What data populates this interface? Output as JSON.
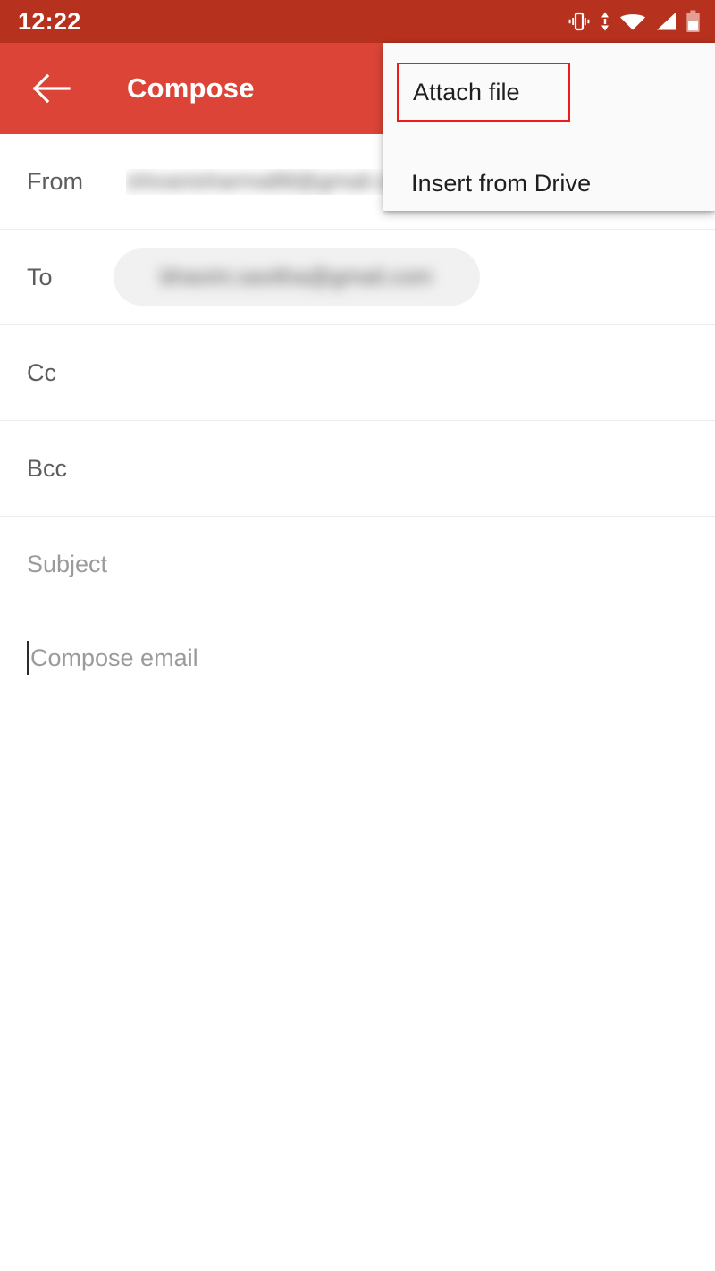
{
  "status_bar": {
    "time": "12:22",
    "background_color": "#b7321e",
    "icons": [
      {
        "name": "vibrate-icon",
        "label": "Vibrate mode"
      },
      {
        "name": "data-transfer-icon",
        "label": "Data transfer"
      },
      {
        "name": "wifi-icon",
        "label": "Wi-Fi signal full"
      },
      {
        "name": "cellular-signal-icon",
        "label": "Cellular signal"
      },
      {
        "name": "battery-icon",
        "label": "Battery low"
      }
    ]
  },
  "app_bar": {
    "title": "Compose",
    "back_icon": "back-arrow-icon",
    "background_color": "#db4437",
    "text_color": "#ffffff"
  },
  "overflow_menu": {
    "visible": true,
    "background_color": "#fafafa",
    "highlight_color": "#ef1b1b",
    "items": [
      {
        "label": "Attach file",
        "highlighted": true
      },
      {
        "label": "Insert from Drive",
        "highlighted": false
      }
    ]
  },
  "compose_form": {
    "fields": [
      {
        "label": "From",
        "value": "redacted-sender-address",
        "redacted": true,
        "type": "from"
      },
      {
        "label": "To",
        "value": "redacted-recipient-address",
        "redacted": true,
        "type": "chip"
      },
      {
        "label": "Cc",
        "value": "",
        "redacted": false,
        "type": "plain"
      },
      {
        "label": "Bcc",
        "value": "",
        "redacted": false,
        "type": "plain"
      }
    ],
    "subject": {
      "placeholder": "Subject",
      "value": ""
    },
    "body": {
      "placeholder": "Compose email",
      "value": "",
      "caret_visible": true
    }
  }
}
